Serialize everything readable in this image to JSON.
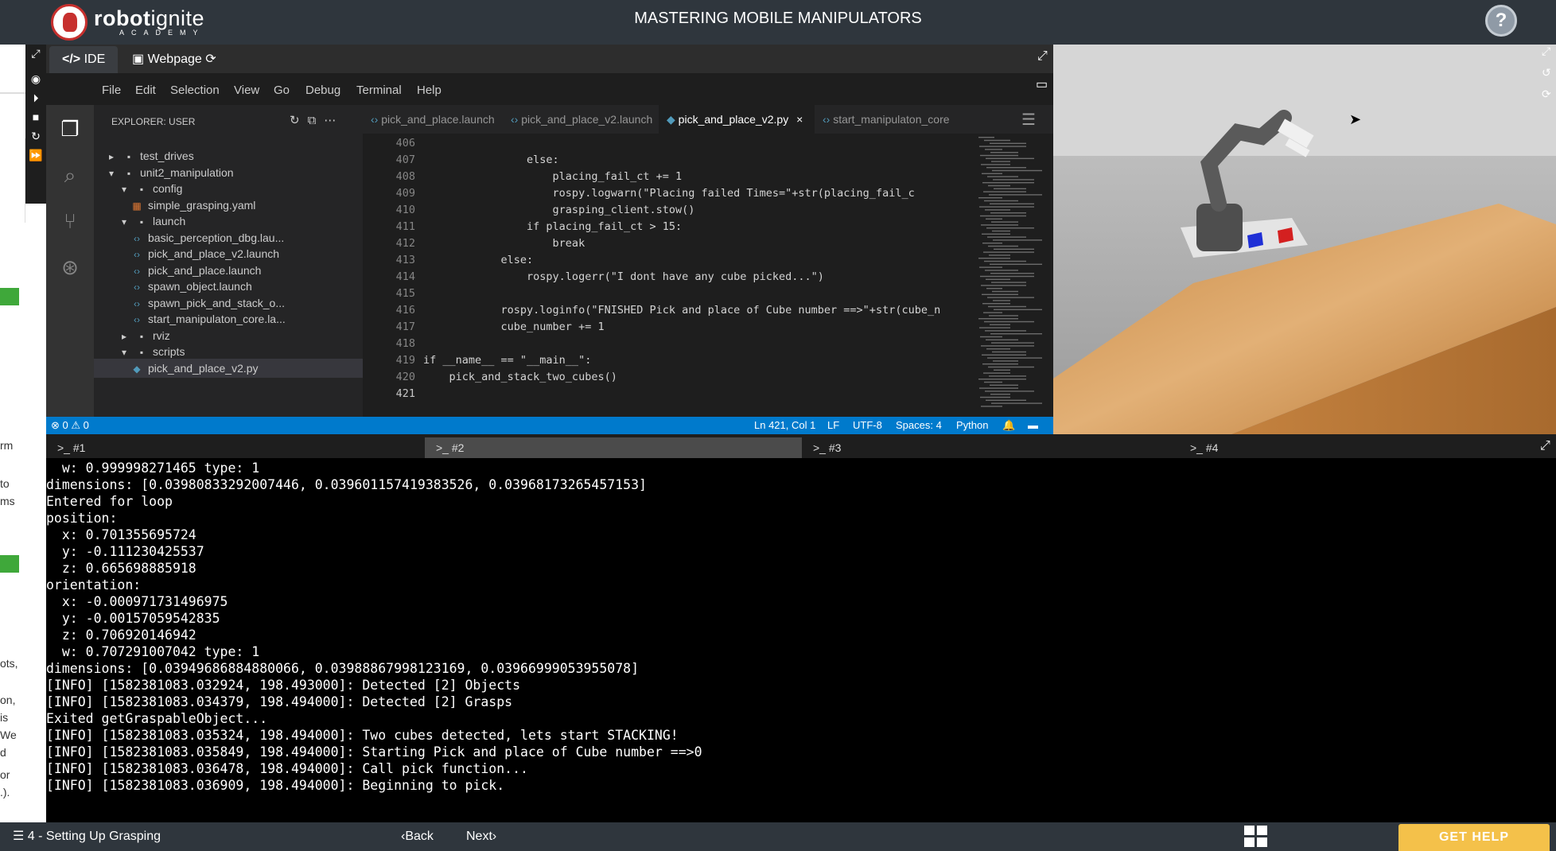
{
  "header": {
    "logo_bold": "robot",
    "logo_light": "ignite",
    "logo_sub": "ACADEMY",
    "course_title": "MASTERING MOBILE MANIPULATORS",
    "help_label": "?"
  },
  "notebook": {
    "fragments": [
      "rm",
      "to",
      "ms",
      "ots,",
      "on,",
      "is",
      "We",
      "d",
      "or",
      ".)."
    ]
  },
  "ide": {
    "tabs": [
      {
        "label": "IDE",
        "icon": "code-icon"
      },
      {
        "label": "Webpage",
        "icon": "html5-icon"
      }
    ],
    "menu": [
      "File",
      "Edit",
      "Selection",
      "View",
      "Go",
      "Debug",
      "Terminal",
      "Help"
    ],
    "explorer": {
      "title": "EXPLORER: USER",
      "tree": [
        {
          "label": "test_drives",
          "type": "folder",
          "expanded": false,
          "depth": 0
        },
        {
          "label": "unit2_manipulation",
          "type": "folder",
          "expanded": true,
          "depth": 0
        },
        {
          "label": "config",
          "type": "folder",
          "expanded": true,
          "depth": 1
        },
        {
          "label": "simple_grasping.yaml",
          "type": "yaml",
          "depth": 2
        },
        {
          "label": "launch",
          "type": "folder",
          "expanded": true,
          "depth": 1
        },
        {
          "label": "basic_perception_dbg.lau...",
          "type": "launch",
          "depth": 2
        },
        {
          "label": "pick_and_place_v2.launch",
          "type": "launch",
          "depth": 2
        },
        {
          "label": "pick_and_place.launch",
          "type": "launch",
          "depth": 2
        },
        {
          "label": "spawn_object.launch",
          "type": "launch",
          "depth": 2
        },
        {
          "label": "spawn_pick_and_stack_o...",
          "type": "launch",
          "depth": 2
        },
        {
          "label": "start_manipulaton_core.la...",
          "type": "launch",
          "depth": 2
        },
        {
          "label": "rviz",
          "type": "folder",
          "expanded": false,
          "depth": 1
        },
        {
          "label": "scripts",
          "type": "folder",
          "expanded": true,
          "depth": 1
        },
        {
          "label": "pick_and_place_v2.py",
          "type": "python",
          "depth": 2,
          "selected": true
        }
      ]
    },
    "editor_tabs": [
      {
        "label": "pick_and_place.launch",
        "active": false
      },
      {
        "label": "pick_and_place_v2.launch",
        "active": false
      },
      {
        "label": "pick_and_place_v2.py",
        "active": true
      },
      {
        "label": "start_manipulaton_core",
        "active": false
      }
    ],
    "code": [
      {
        "n": "406",
        "text": ""
      },
      {
        "n": "407",
        "text": "                else:"
      },
      {
        "n": "408",
        "text": "                    placing_fail_ct += 1"
      },
      {
        "n": "409",
        "text": "                    rospy.logwarn(\"Placing failed Times=\"+str(placing_fail_c"
      },
      {
        "n": "410",
        "text": "                    grasping_client.stow()"
      },
      {
        "n": "411",
        "text": "                if placing_fail_ct > 15:"
      },
      {
        "n": "412",
        "text": "                    break"
      },
      {
        "n": "413",
        "text": "            else:"
      },
      {
        "n": "414",
        "text": "                rospy.logerr(\"I dont have any cube picked...\")"
      },
      {
        "n": "415",
        "text": ""
      },
      {
        "n": "416",
        "text": "            rospy.loginfo(\"FNISHED Pick and place of Cube number ==>\"+str(cube_n"
      },
      {
        "n": "417",
        "text": "            cube_number += 1"
      },
      {
        "n": "418",
        "text": ""
      },
      {
        "n": "419",
        "text": "if __name__ == \"__main__\":"
      },
      {
        "n": "420",
        "text": "    pick_and_stack_two_cubes()"
      },
      {
        "n": "421",
        "text": ""
      }
    ],
    "status": {
      "errors": "0",
      "warnings": "0",
      "position": "Ln 421, Col 1",
      "eol": "LF",
      "encoding": "UTF-8",
      "spaces": "Spaces: 4",
      "language": "Python"
    }
  },
  "terminals": {
    "tabs": [
      ">_ #1",
      ">_ #2",
      ">_ #3",
      ">_ #4"
    ],
    "active": 1,
    "lines": [
      "  w: 0.999998271465 type: 1",
      "dimensions: [0.03980833292007446, 0.039601157419383526, 0.03968173265457153]",
      "Entered for loop",
      "position:",
      "  x: 0.701355695724",
      "  y: -0.111230425537",
      "  z: 0.665698885918",
      "orientation:",
      "  x: -0.000971731496975",
      "  y: -0.00157059542835",
      "  z: 0.706920146942",
      "  w: 0.707291007042 type: 1",
      "dimensions: [0.03949686884880066, 0.03988867998123169, 0.03966999053955078]",
      "[INFO] [1582381083.032924, 198.493000]: Detected [2] Objects",
      "[INFO] [1582381083.034379, 198.494000]: Detected [2] Grasps",
      "Exited getGraspableObject...",
      "[INFO] [1582381083.035324, 198.494000]: Two cubes detected, lets start STACKING!",
      "[INFO] [1582381083.035849, 198.494000]: Starting Pick and place of Cube number ==>0",
      "[INFO] [1582381083.036478, 198.494000]: Call pick function...",
      "[INFO] [1582381083.036909, 198.494000]: Beginning to pick."
    ]
  },
  "footer": {
    "lesson": "4 - Setting Up Grasping",
    "back": "Back",
    "next": "Next",
    "get_help": "GET HELP"
  },
  "colors": {
    "topbar": "#2f363d",
    "statusbar": "#007acc",
    "get_help": "#f4c14a",
    "green": "#3fa83a"
  }
}
